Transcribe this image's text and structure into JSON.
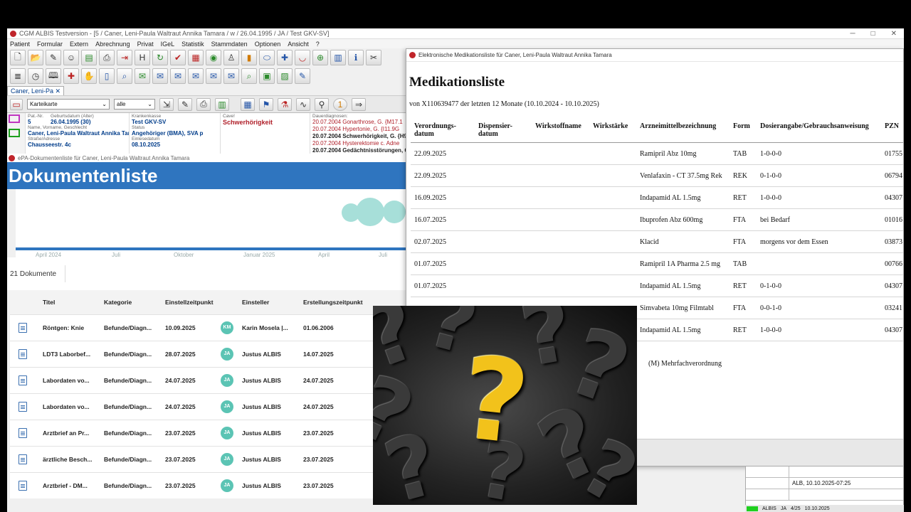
{
  "albis": {
    "window_title": "CGM ALBIS Testversion - [5 / Caner, Leni-Paula Waltraut Annika Tamara / w / 26.04.1995 / JA / Test GKV-SV]",
    "menu": [
      "Patient",
      "Formular",
      "Extern",
      "Abrechnung",
      "Privat",
      "IGeL",
      "Statistik",
      "Stammdaten",
      "Optionen",
      "Ansicht",
      "?"
    ],
    "patient_tab": "Caner, Leni-Pa",
    "karteikarte_select": "Karteikarte",
    "filter_select": "alle",
    "patient": {
      "pat_nr_label": "Pat.-Nr.",
      "pat_nr": "5",
      "geb_label": "Geburtsdatum (Alter)",
      "geb": "26.04.1995 (30)",
      "name_label": "Name, Vorname, Geschlecht",
      "name": "Caner, Leni-Paula Waltraut Annika Tam",
      "street_label": "Straße/Adresse",
      "street": "Chausseestr. 4c",
      "kk_label": "Krankenkasse",
      "kk": "Test GKV-SV",
      "status_label": "Status",
      "status": "Angehöriger (BMA), SVA p",
      "einlese_label": "Einlesedatum",
      "einlese": "08.10.2025",
      "cave_label": "Cave!",
      "cave": "Schwerhörigkeit",
      "dauer_label": "Dauerdiagnosen:",
      "diagnoses": [
        "20.07.2004 Gonarthrose, G. {M17.1",
        "20.07.2004 Hypertonie, G. {I11.9G",
        "20.07.2004 Schwerhörigkeit, G. {H9",
        "20.07.2004 Hysterektomie c. Adne",
        "20.07.2004 Gedächtnisstörungen, G"
      ]
    }
  },
  "epa": {
    "window_title": "ePA-Dokumentenliste für Caner, Leni-Paula Waltraut Annika Tamara",
    "header": "Dokumentenliste",
    "months": [
      "April 2024",
      "Juli",
      "Oktober",
      "Januar 2025",
      "April",
      "Juli"
    ],
    "count": "21 Dokumente",
    "columns": [
      "Titel",
      "Kategorie",
      "Einstellzeitpunkt",
      "Einsteller",
      "Erstellungszeitpunkt"
    ],
    "rows": [
      {
        "title": "Röntgen: Knie",
        "category": "Befunde/Diagn...",
        "einstell": "10.09.2025",
        "initials": "KM",
        "einsteller": "Karin Mosela |...",
        "erstellt": "01.06.2006"
      },
      {
        "title": "LDT3 Laborbef...",
        "category": "Befunde/Diagn...",
        "einstell": "28.07.2025",
        "initials": "JA",
        "einsteller": "Justus ALBIS",
        "erstellt": "14.07.2025"
      },
      {
        "title": "Labordaten vo...",
        "category": "Befunde/Diagn...",
        "einstell": "24.07.2025",
        "initials": "JA",
        "einsteller": "Justus ALBIS",
        "erstellt": "24.07.2025"
      },
      {
        "title": "Labordaten vo...",
        "category": "Befunde/Diagn...",
        "einstell": "24.07.2025",
        "initials": "JA",
        "einsteller": "Justus ALBIS",
        "erstellt": "24.07.2025"
      },
      {
        "title": "Arztbrief an Pr...",
        "category": "Befunde/Diagn...",
        "einstell": "23.07.2025",
        "initials": "JA",
        "einsteller": "Justus ALBIS",
        "erstellt": "23.07.2025"
      },
      {
        "title": "ärztliche Besch...",
        "category": "Befunde/Diagn...",
        "einstell": "23.07.2025",
        "initials": "JA",
        "einsteller": "Justus ALBIS",
        "erstellt": "23.07.2025"
      },
      {
        "title": "Arztbrief - DM...",
        "category": "Befunde/Diagn...",
        "einstell": "23.07.2025",
        "initials": "JA",
        "einsteller": "Justus ALBIS",
        "erstellt": "23.07.2025"
      }
    ]
  },
  "med": {
    "window_title": "Elektronische Medikationsliste für Caner, Leni-Paula Waltraut Annika Tamara",
    "heading": "Medikationsliste",
    "subtitle": "von X110639477 der letzten 12 Monate (10.10.2024 - 10.10.2025)",
    "columns": [
      "Verordnungs-datum",
      "Dispensier-datum",
      "Wirkstoffname",
      "Wirkstärke",
      "Arzneimittelbezeichnung",
      "Form",
      "Dosierangabe/Gebrauchsanweisung",
      "PZN"
    ],
    "rows": [
      {
        "date": "22.09.2025",
        "disp": "",
        "wirk": "",
        "staerke": "",
        "name": "Ramipril Abz 10mg",
        "form": "TAB",
        "dosis": "1-0-0-0",
        "pzn": "01755"
      },
      {
        "date": "22.09.2025",
        "disp": "",
        "wirk": "",
        "staerke": "",
        "name": "Venlafaxin - CT 37.5mg Rek",
        "form": "REK",
        "dosis": "0-1-0-0",
        "pzn": "06794"
      },
      {
        "date": "16.09.2025",
        "disp": "",
        "wirk": "",
        "staerke": "",
        "name": "Indapamid AL 1.5mg",
        "form": "RET",
        "dosis": "1-0-0-0",
        "pzn": "04307"
      },
      {
        "date": "16.07.2025",
        "disp": "",
        "wirk": "",
        "staerke": "",
        "name": "Ibuprofen Abz 600mg",
        "form": "FTA",
        "dosis": "bei Bedarf",
        "pzn": "01016"
      },
      {
        "date": "02.07.2025",
        "disp": "",
        "wirk": "",
        "staerke": "",
        "name": "Klacid",
        "form": "FTA",
        "dosis": "morgens vor dem Essen",
        "pzn": "03873"
      },
      {
        "date": "01.07.2025",
        "disp": "",
        "wirk": "",
        "staerke": "",
        "name": "Ramipril 1A Pharma 2.5 mg",
        "form": "TAB",
        "dosis": "",
        "pzn": "00766"
      },
      {
        "date": "01.07.2025",
        "disp": "",
        "wirk": "",
        "staerke": "",
        "name": "Indapamid AL 1.5mg",
        "form": "RET",
        "dosis": "0-1-0-0",
        "pzn": "04307"
      },
      {
        "date": "",
        "disp": "",
        "wirk": "",
        "staerke": "",
        "name": "Simvabeta 10mg Filmtabl",
        "form": "FTA",
        "dosis": "0-0-1-0",
        "pzn": "03241"
      },
      {
        "date": "",
        "disp": "",
        "wirk": "",
        "staerke": "",
        "name": "Indapamid AL 1.5mg",
        "form": "RET",
        "dosis": "1-0-0-0",
        "pzn": "04307"
      }
    ],
    "footnote": "(M) Mehrfachverordnung"
  },
  "side": {
    "row1": "ALB, 10.10.2025-07:25",
    "status_alb": "ALBIS",
    "status_user": "JA",
    "status_page": "4/25",
    "status_date": "10.10.2025"
  }
}
